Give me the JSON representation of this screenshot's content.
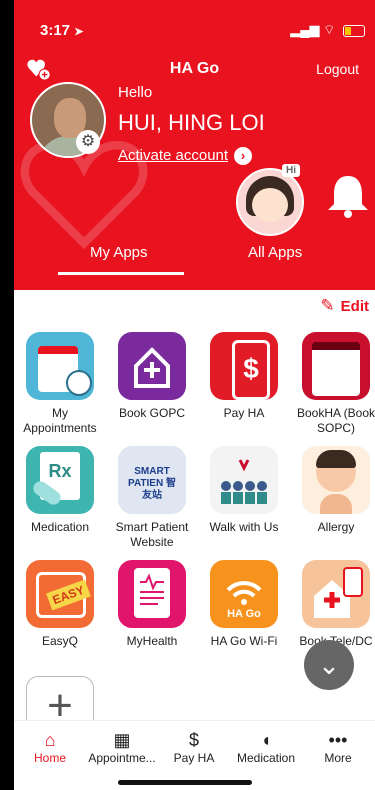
{
  "status_bar": {
    "time": "3:17",
    "location_glyph": "➤",
    "signal_glyph": "▂▄▆",
    "wifi_glyph": "⌔"
  },
  "header": {
    "title": "HA Go",
    "logout_label": "Logout",
    "greeting": "Hello",
    "user_name": "HUI, HING LOI",
    "activate_label": "Activate account",
    "activate_arrow": "›",
    "hi_badge": "Hi"
  },
  "tabs": [
    {
      "label": "My Apps"
    },
    {
      "label": "All Apps"
    }
  ],
  "edit_label": "Edit",
  "apps": [
    {
      "label": "My Appointments",
      "icon": "calendar-clock-icon"
    },
    {
      "label": "Book GOPC",
      "icon": "medical-house-icon"
    },
    {
      "label": "Pay HA",
      "icon": "phone-dollar-icon"
    },
    {
      "label": "BookHA (Book SOPC)",
      "icon": "calendar-icon"
    },
    {
      "label": "Medication",
      "icon": "rx-pill-icon"
    },
    {
      "label": "Smart Patient Website",
      "icon": "smart-patient-icon"
    },
    {
      "label": "Walk with Us",
      "icon": "people-icon"
    },
    {
      "label": "Allergy",
      "icon": "allergy-icon"
    },
    {
      "label": "EasyQ",
      "icon": "easyq-icon"
    },
    {
      "label": "MyHealth",
      "icon": "health-record-icon"
    },
    {
      "label": "HA Go Wi-Fi",
      "icon": "wifi-icon"
    },
    {
      "label": "Book Tele/DC",
      "icon": "tele-house-icon"
    }
  ],
  "app_icon_text": {
    "pay_symbol": "$",
    "rx": "Rx",
    "smart": "SMART PATIEN 智友站",
    "easy": "EASY",
    "hago": "HA Go"
  },
  "fab_glyph": "⌄",
  "add_glyph": "+",
  "bottom_nav": [
    {
      "label": "Home",
      "icon": "home-icon",
      "glyph": "⌂"
    },
    {
      "label": "Appointme...",
      "icon": "calendar-icon",
      "glyph": "▦"
    },
    {
      "label": "Pay HA",
      "icon": "phone-dollar-icon",
      "glyph": "$"
    },
    {
      "label": "Medication",
      "icon": "pill-icon",
      "glyph": "◖"
    },
    {
      "label": "More",
      "icon": "more-icon",
      "glyph": "•••"
    }
  ],
  "colors": {
    "brand_red": "#e8131f"
  }
}
